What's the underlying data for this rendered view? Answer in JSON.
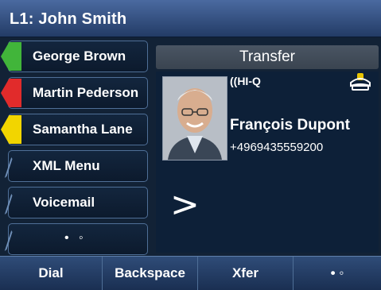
{
  "header": {
    "title": "L1: John Smith"
  },
  "line_keys": [
    {
      "label": "George Brown",
      "status": "available",
      "status_color": "#41b53a"
    },
    {
      "label": "Martin Pederson",
      "status": "busy",
      "status_color": "#e12b2b"
    },
    {
      "label": "Samantha Lane",
      "status": "ringing",
      "status_color": "#f2d500"
    },
    {
      "label": "XML Menu"
    },
    {
      "label": "Voicemail"
    },
    {
      "label": "• ◦"
    }
  ],
  "contact_panel": {
    "header": "Transfer",
    "brand": "((HI-Q",
    "handset_icon": "handset-icon",
    "name": "François Dupont",
    "number": "+4969435559200",
    "arrow": ">"
  },
  "softkeys": [
    {
      "label": "Dial"
    },
    {
      "label": "Backspace"
    },
    {
      "label": "Xfer"
    },
    {
      "label": "• ◦"
    }
  ]
}
